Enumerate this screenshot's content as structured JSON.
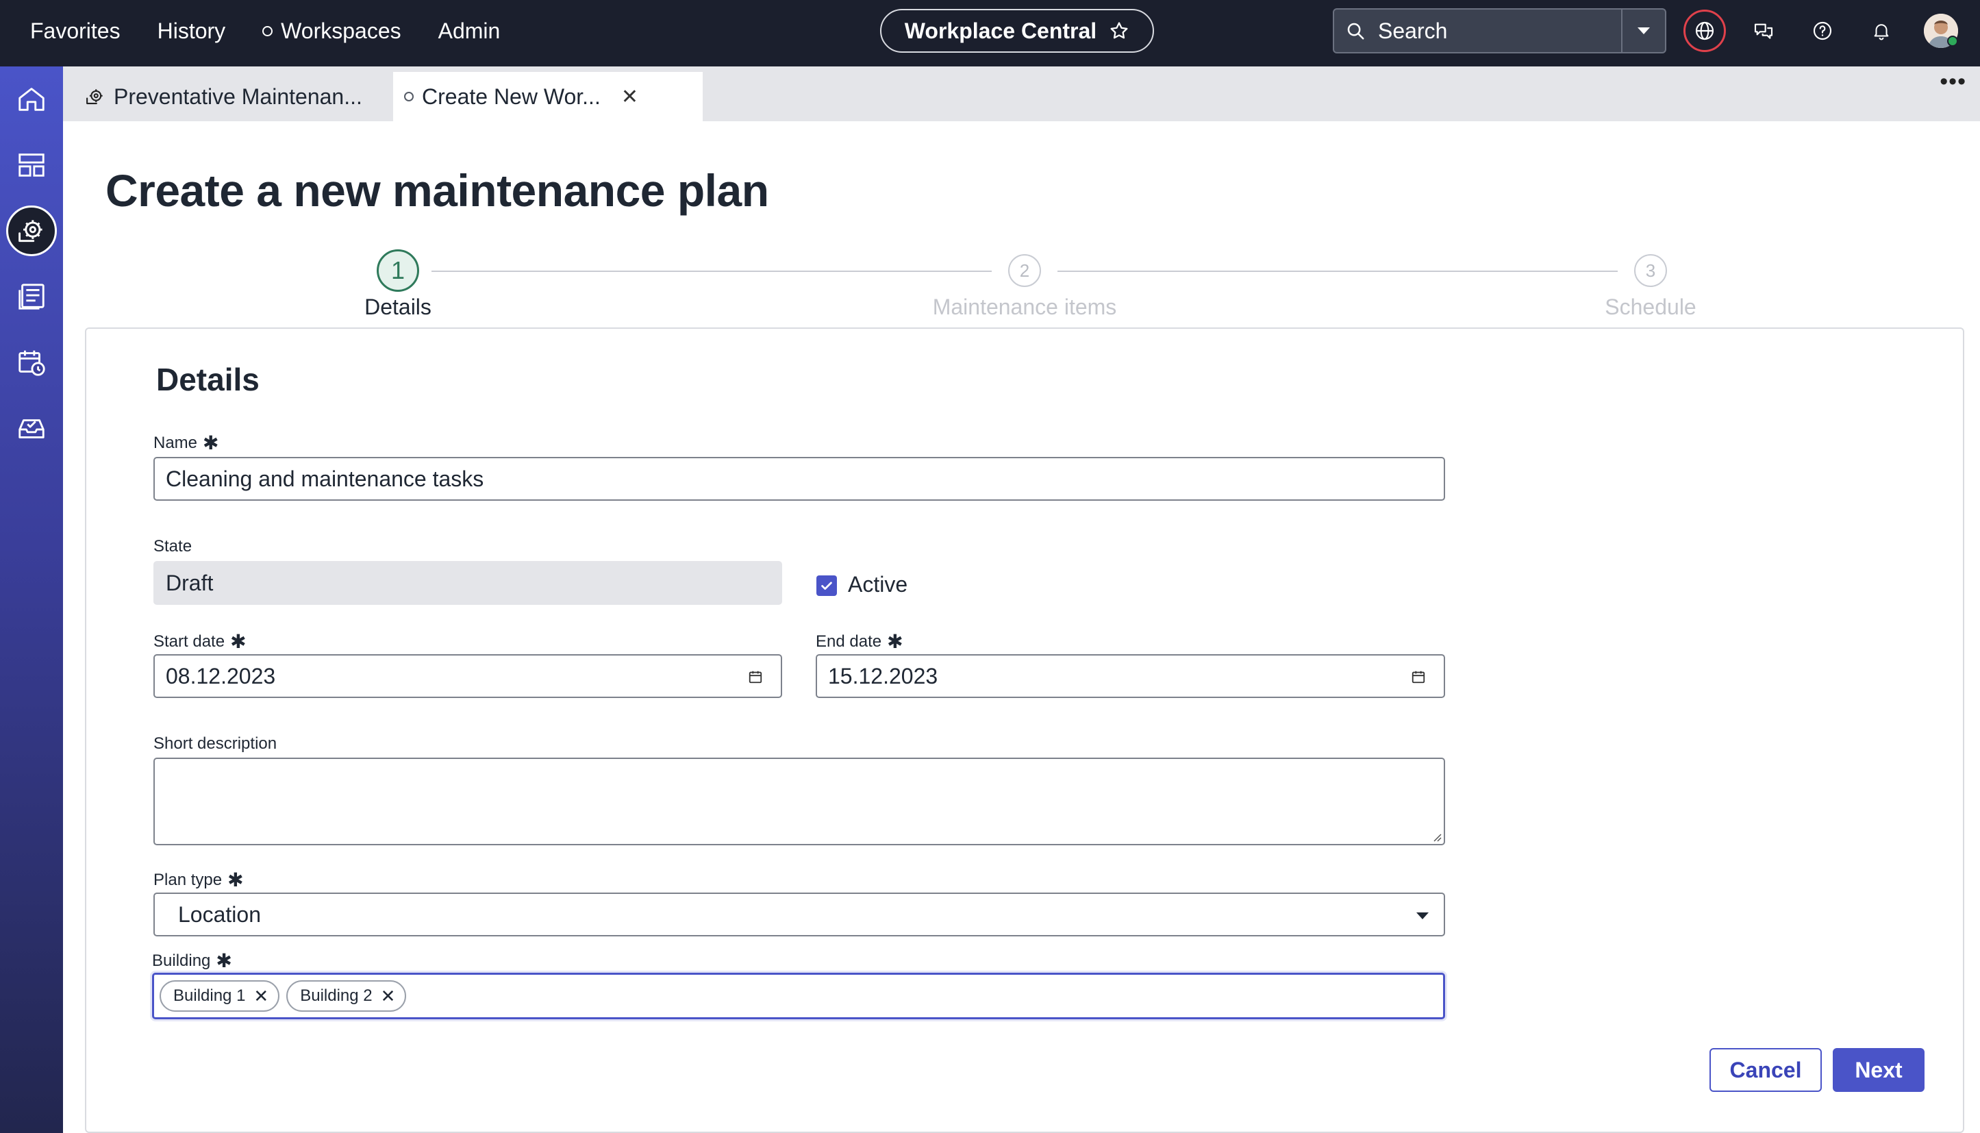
{
  "topbar": {
    "nav": [
      "Favorites",
      "History",
      "Workspaces",
      "Admin"
    ],
    "app_title": "Workplace Central",
    "search_placeholder": "Search"
  },
  "tabs": [
    {
      "label": "Preventative Maintenan..."
    },
    {
      "label": "Create New Wor..."
    }
  ],
  "page": {
    "title": "Create a new maintenance plan"
  },
  "stepper": [
    {
      "number": "1",
      "label": "Details",
      "state": "current"
    },
    {
      "number": "2",
      "label": "Maintenance items",
      "state": "upcoming"
    },
    {
      "number": "3",
      "label": "Schedule",
      "state": "upcoming"
    }
  ],
  "form": {
    "section_title": "Details",
    "name": {
      "label": "Name",
      "value": "Cleaning and maintenance tasks"
    },
    "state": {
      "label": "State",
      "value": "Draft"
    },
    "active": {
      "label": "Active",
      "checked": true
    },
    "start_date": {
      "label": "Start date",
      "value": "08.12.2023"
    },
    "end_date": {
      "label": "End date",
      "value": "15.12.2023"
    },
    "short_description": {
      "label": "Short description",
      "value": ""
    },
    "plan_type": {
      "label": "Plan type",
      "value": "Location"
    },
    "building": {
      "label": "Building",
      "tags": [
        "Building 1",
        "Building 2"
      ]
    }
  },
  "actions": {
    "cancel": "Cancel",
    "next": "Next"
  },
  "colors": {
    "topbar": "#1b1f2d",
    "accent": "#4a54c8",
    "step_current": "#2f7a5b"
  }
}
